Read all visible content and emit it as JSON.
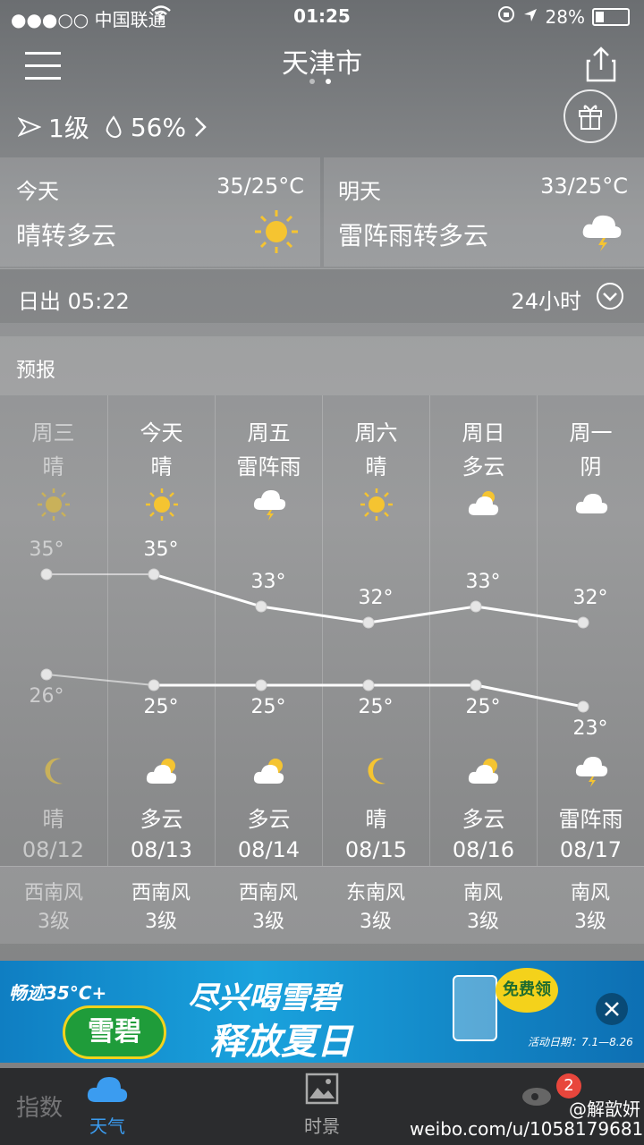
{
  "status_bar": {
    "carrier": "●●●○○ 中国联通",
    "time": "01:25",
    "battery": "28%"
  },
  "header": {
    "city": "天津市",
    "wind_level": "1级",
    "humidity": "56%"
  },
  "today": {
    "label": "今天",
    "temp": "35/25°C",
    "condition": "晴转多云",
    "icon": "sun-icon"
  },
  "tomorrow": {
    "label": "明天",
    "temp": "33/25°C",
    "condition": "雷阵雨转多云",
    "icon": "thunder-cloud-icon"
  },
  "sunrise": {
    "text": "日出 05:22",
    "toggle_label": "24小时"
  },
  "forecast": {
    "title": "预报",
    "days": [
      {
        "weekday": "周三",
        "day_weather": "晴",
        "high": "35°",
        "low": "26°",
        "night_weather": "晴",
        "date": "08/12",
        "wind_dir": "西南风",
        "wind_level": "3级",
        "day_icon": "sun-icon",
        "night_icon": "moon-icon",
        "past": true
      },
      {
        "weekday": "今天",
        "day_weather": "晴",
        "high": "35°",
        "low": "25°",
        "night_weather": "多云",
        "date": "08/13",
        "wind_dir": "西南风",
        "wind_level": "3级",
        "day_icon": "sun-icon",
        "night_icon": "moon-cloud-icon",
        "past": false
      },
      {
        "weekday": "周五",
        "day_weather": "雷阵雨",
        "high": "33°",
        "low": "25°",
        "night_weather": "多云",
        "date": "08/14",
        "wind_dir": "西南风",
        "wind_level": "3级",
        "day_icon": "thunder-cloud-icon",
        "night_icon": "moon-cloud-icon",
        "past": false
      },
      {
        "weekday": "周六",
        "day_weather": "晴",
        "high": "32°",
        "low": "25°",
        "night_weather": "晴",
        "date": "08/15",
        "wind_dir": "东南风",
        "wind_level": "3级",
        "day_icon": "sun-icon",
        "night_icon": "moon-icon",
        "past": false
      },
      {
        "weekday": "周日",
        "day_weather": "多云",
        "high": "33°",
        "low": "25°",
        "night_weather": "多云",
        "date": "08/16",
        "wind_dir": "南风",
        "wind_level": "3级",
        "day_icon": "sun-cloud-icon",
        "night_icon": "moon-cloud-icon",
        "past": false
      },
      {
        "weekday": "周一",
        "day_weather": "阴",
        "high": "32°",
        "low": "23°",
        "night_weather": "雷阵雨",
        "date": "08/17",
        "wind_dir": "南风",
        "wind_level": "3级",
        "day_icon": "cloud-icon",
        "night_icon": "thunder-cloud-icon",
        "past": false
      }
    ]
  },
  "chart_data": {
    "type": "line",
    "categories": [
      "08/12",
      "08/13",
      "08/14",
      "08/15",
      "08/16",
      "08/17"
    ],
    "series": [
      {
        "values": [
          35,
          35,
          33,
          32,
          33,
          32
        ]
      },
      {
        "values": [
          26,
          25,
          25,
          25,
          25,
          23
        ]
      }
    ]
  },
  "ad": {
    "line1": "畅迹35°C+",
    "line2": "尽兴喝雪碧",
    "line3": "释放夏日",
    "badge": "免费领",
    "date": "活动日期：7.1—8.26",
    "brand": "雪碧",
    "colors": {
      "bg": "#1aa2dd",
      "green": "#1f9c3a",
      "yellow": "#f4d21b"
    }
  },
  "tabbar": {
    "index_label": "指数",
    "weather_label": "天气",
    "scene_label": "时景",
    "badge_count": "2"
  },
  "watermark": {
    "text": "weibo.com/u/1058179681",
    "handle": "@解歆妍"
  }
}
